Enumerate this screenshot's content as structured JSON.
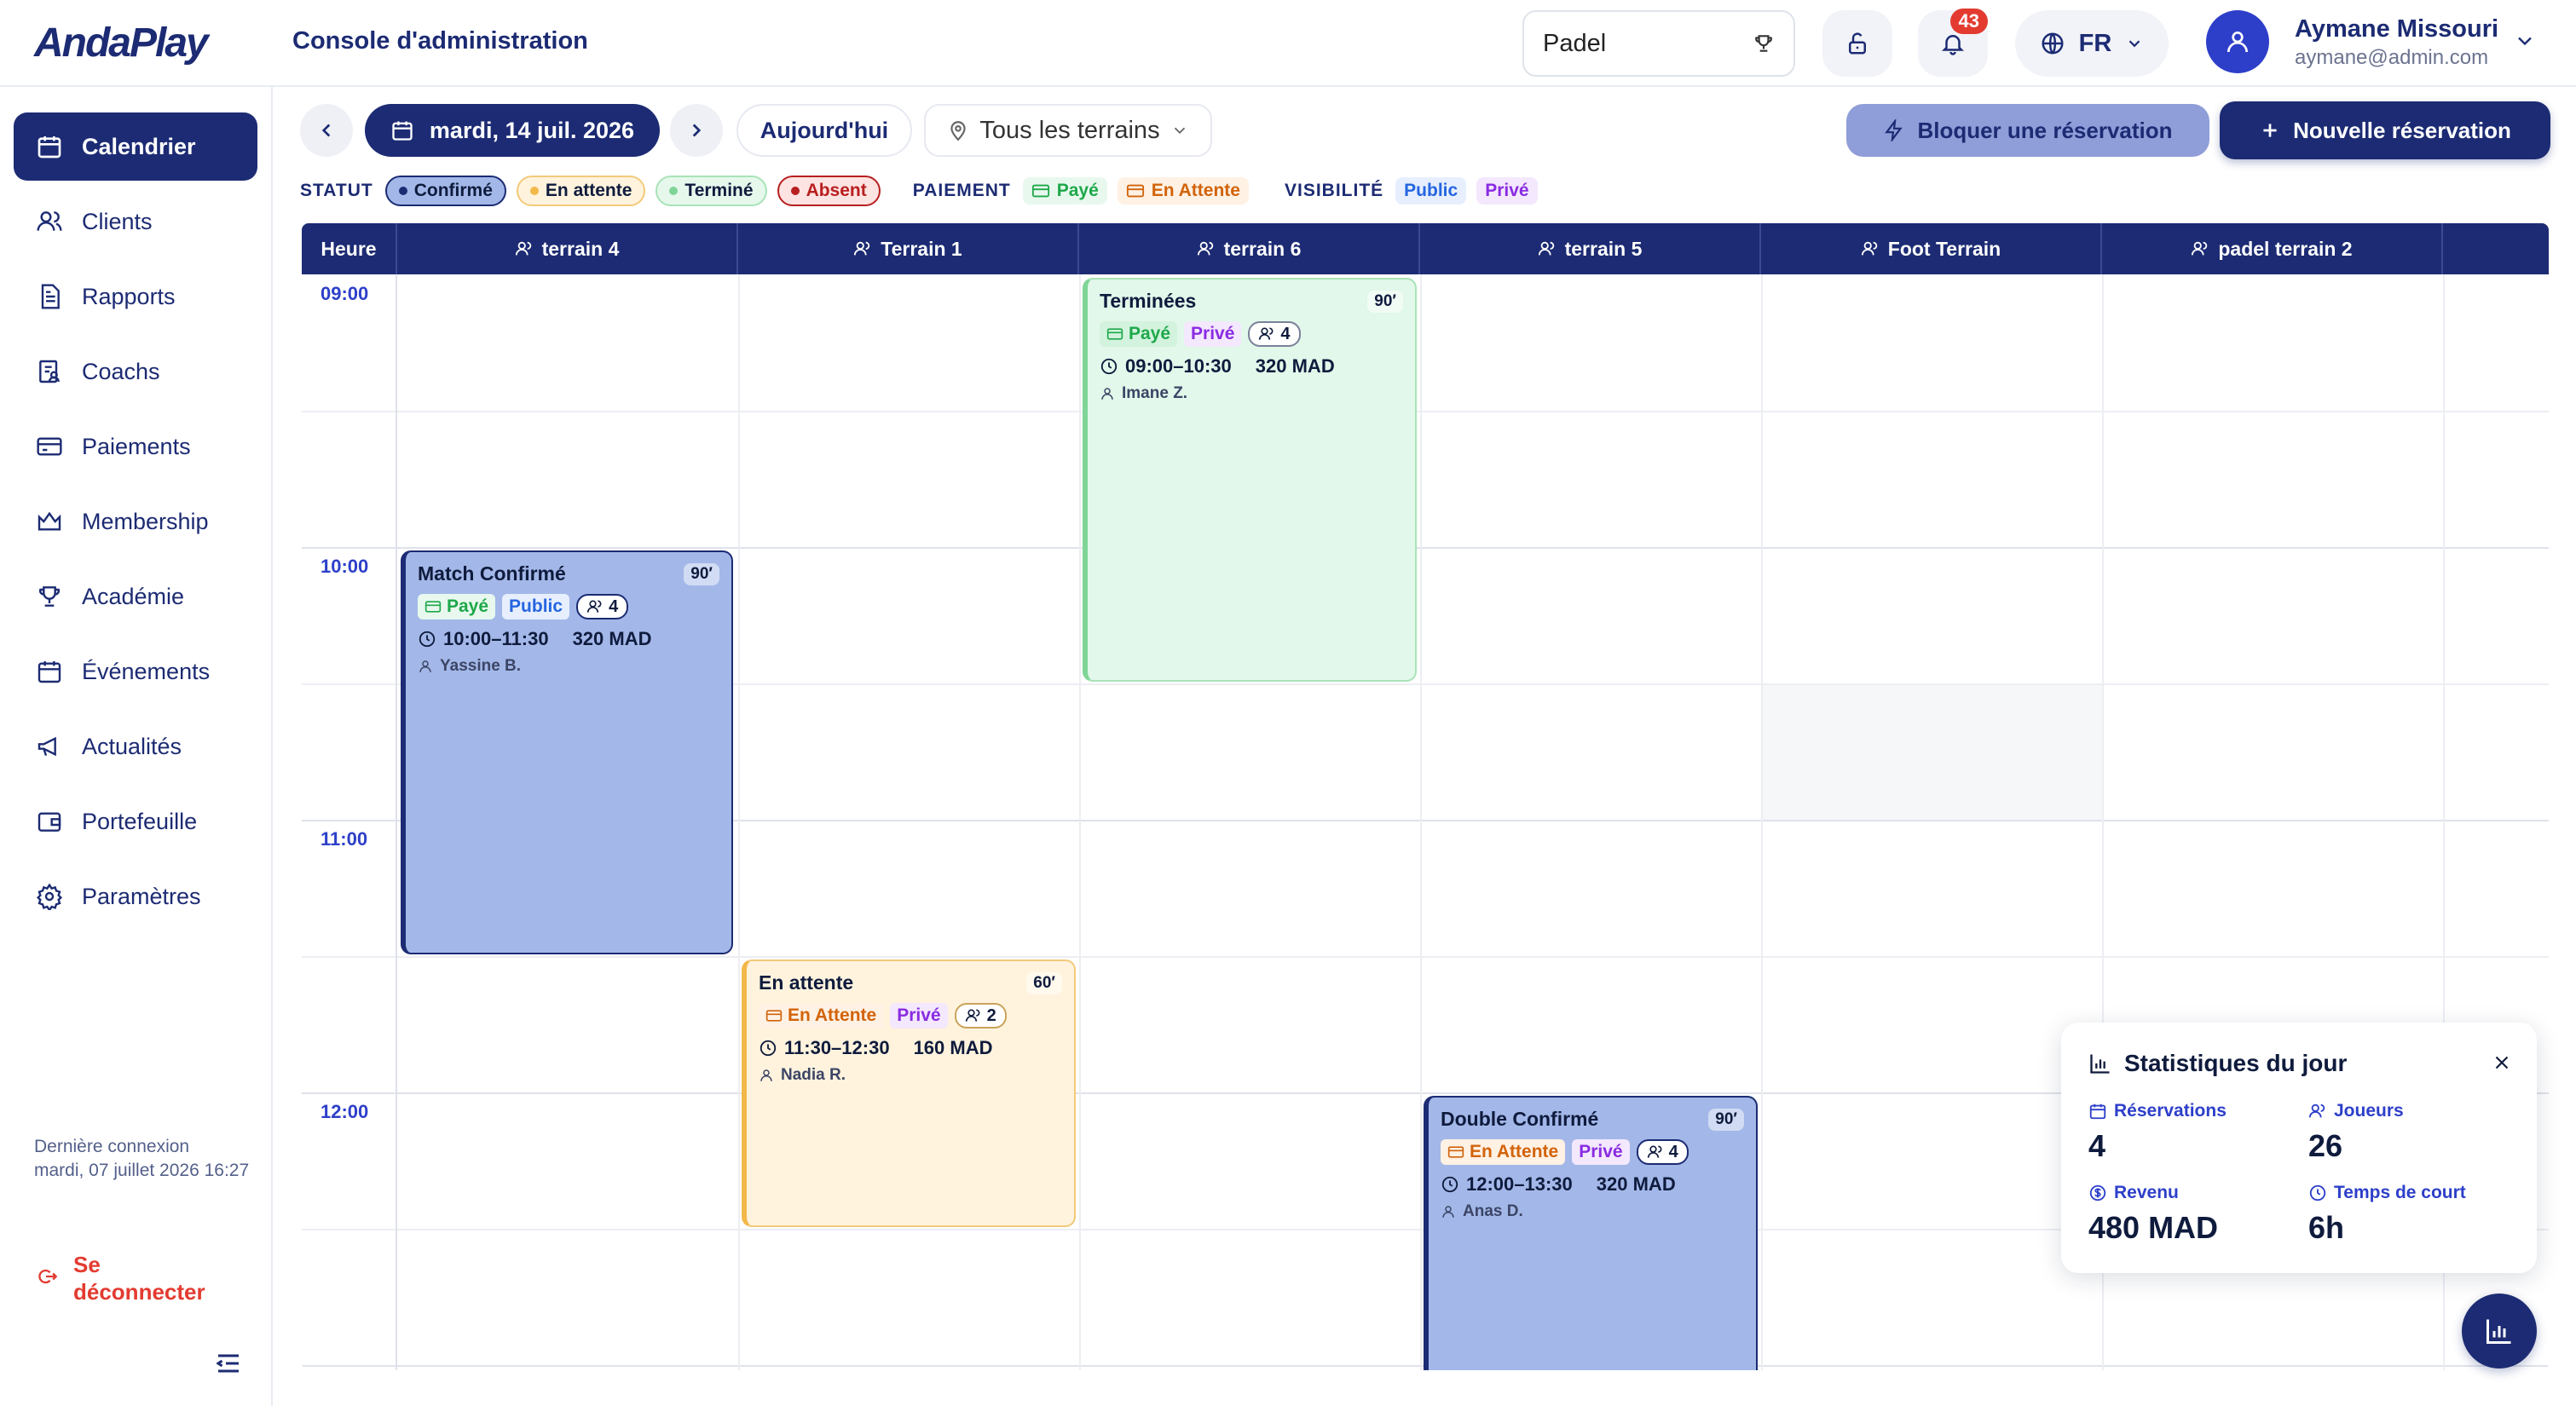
{
  "brand": {
    "logo_text": "AndaPlay"
  },
  "header": {
    "title": "Console d'administration",
    "sport": "Padel",
    "notifications_count": "43",
    "language": "FR",
    "user_name": "Aymane Missouri",
    "user_email": "aymane@admin.com"
  },
  "sidebar": {
    "items": [
      "Calendrier",
      "Clients",
      "Rapports",
      "Coachs",
      "Paiements",
      "Membership",
      "Académie",
      "Événements",
      "Actualités",
      "Portefeuille",
      "Paramètres"
    ],
    "last_login_label": "Dernière connexion",
    "last_login_value": "mardi, 07 juillet 2026 16:27",
    "logout": "Se déconnecter"
  },
  "toolbar": {
    "date": "mardi, 14 juil. 2026",
    "today": "Aujourd'hui",
    "courts": "Tous les terrains",
    "block": "Bloquer une réservation",
    "new": "Nouvelle réservation"
  },
  "filters": {
    "status_label": "STATUT",
    "statuses": [
      "Confirmé",
      "En attente",
      "Terminé",
      "Absent"
    ],
    "payment_label": "PAIEMENT",
    "payments": [
      "Payé",
      "En Attente"
    ],
    "visibility_label": "VISIBILITÉ",
    "visibilities": [
      "Public",
      "Privé"
    ]
  },
  "grid": {
    "hour_header": "Heure",
    "courts": [
      "terrain 4",
      "Terrain 1",
      "terrain 6",
      "terrain 5",
      "Foot Terrain",
      "padel terrain 2"
    ],
    "hours": [
      "09:00",
      "10:00",
      "11:00",
      "12:00"
    ]
  },
  "events": [
    {
      "title": "Match Confirmé",
      "duration": "90′",
      "payment": "Payé",
      "visibility": "Public",
      "players": "4",
      "time": "10:00–11:30",
      "price": "320 MAD",
      "client": "Yassine B."
    },
    {
      "title": "Terminées",
      "duration": "90′",
      "payment": "Payé",
      "visibility": "Privé",
      "players": "4",
      "time": "09:00–10:30",
      "price": "320 MAD",
      "client": "Imane Z."
    },
    {
      "title": "En attente",
      "duration": "60′",
      "payment": "En Attente",
      "visibility": "Privé",
      "players": "2",
      "time": "11:30–12:30",
      "price": "160 MAD",
      "client": "Nadia R."
    },
    {
      "title": "Double Confirmé",
      "duration": "90′",
      "payment": "En Attente",
      "visibility": "Privé",
      "players": "4",
      "time": "12:00–13:30",
      "price": "320 MAD",
      "client": "Anas D."
    }
  ],
  "stats": {
    "title": "Statistiques du jour",
    "reservations_label": "Réservations",
    "reservations": "4",
    "players_label": "Joueurs",
    "players": "26",
    "revenue_label": "Revenu",
    "revenue": "480 MAD",
    "court_time_label": "Temps de court",
    "court_time": "6h"
  },
  "colors": {
    "primary": "#1c2b73",
    "accent": "#2d3fc9",
    "danger": "#e33b30",
    "confirmed_bg": "#a3b8e8",
    "done_bg": "#e2f8ea",
    "pending_bg": "#fff3dd"
  }
}
